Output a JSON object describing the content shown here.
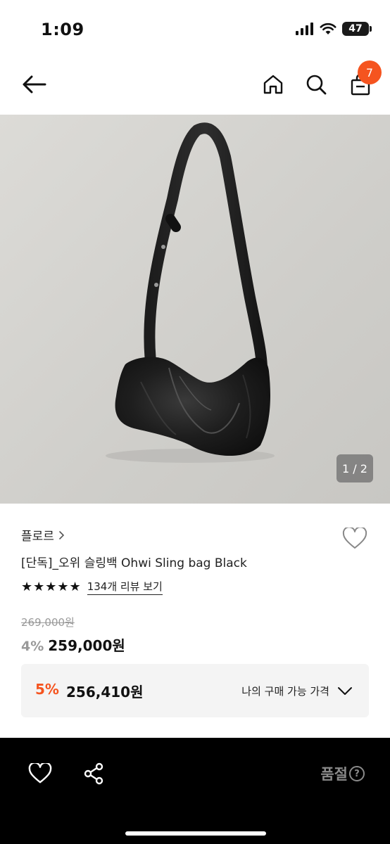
{
  "status": {
    "time": "1:09",
    "battery": "47"
  },
  "header": {
    "back_icon": "arrow-left-icon",
    "home_icon": "home-icon",
    "search_icon": "search-icon",
    "cart_icon": "bag-icon",
    "cart_count": "7"
  },
  "gallery": {
    "counter": "1 / 2"
  },
  "product": {
    "brand": "플로르",
    "title": "[단독]_오위 슬링백 Ohwi Sling bag Black",
    "rating_stars": 5,
    "reviews": "134개 리뷰 보기",
    "original_price": "269,000원",
    "discount": "4%",
    "sale_price": "259,000원"
  },
  "my_price": {
    "discount": "5%",
    "price": "256,410원",
    "label": "나의 구매 가능 가격"
  },
  "bottom_bar": {
    "status": "품절"
  },
  "colors": {
    "accent": "#f5541f",
    "dark": "#000000"
  }
}
